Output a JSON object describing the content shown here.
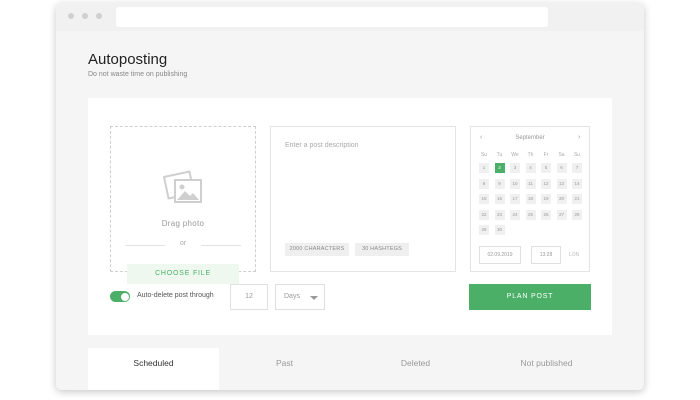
{
  "window": {
    "address_bar": ""
  },
  "page": {
    "title": "Autoposting",
    "subtitle": "Do not waste time on publishing"
  },
  "photo": {
    "icon": "image-gallery-icon",
    "drag_label": "Drag photo",
    "or_label": "or",
    "choose_button": "CHOOSE FILE"
  },
  "description": {
    "placeholder": "Enter a post description",
    "chips": [
      "2000 CHARACTERS",
      "30 HASHTEGS"
    ]
  },
  "calendar": {
    "month": "September",
    "prev": "‹",
    "next": "›",
    "weekdays": [
      "Su",
      "Tu",
      "We",
      "Th",
      "Fr",
      "Sa",
      "Su"
    ],
    "days": [
      "1",
      "2",
      "3",
      "4",
      "5",
      "6",
      "7",
      "8",
      "9",
      "10",
      "11",
      "12",
      "13",
      "14",
      "15",
      "16",
      "17",
      "18",
      "19",
      "20",
      "21",
      "22",
      "23",
      "24",
      "25",
      "26",
      "27",
      "28",
      "29",
      "30"
    ],
    "selected_day": "2",
    "date_value": "02.09.2019",
    "time_value": "13:28",
    "timezone": "LON"
  },
  "auto_delete": {
    "enabled": true,
    "label": "Auto-delete post through",
    "amount": "12",
    "unit": "Days"
  },
  "plan_button": "PLAN POST",
  "colors": {
    "accent": "#4caf68",
    "accent_light": "#eef8ef"
  },
  "tabs": [
    {
      "label": "Scheduled",
      "active": true
    },
    {
      "label": "Past",
      "active": false
    },
    {
      "label": "Deleted",
      "active": false
    },
    {
      "label": "Not published",
      "active": false
    }
  ]
}
